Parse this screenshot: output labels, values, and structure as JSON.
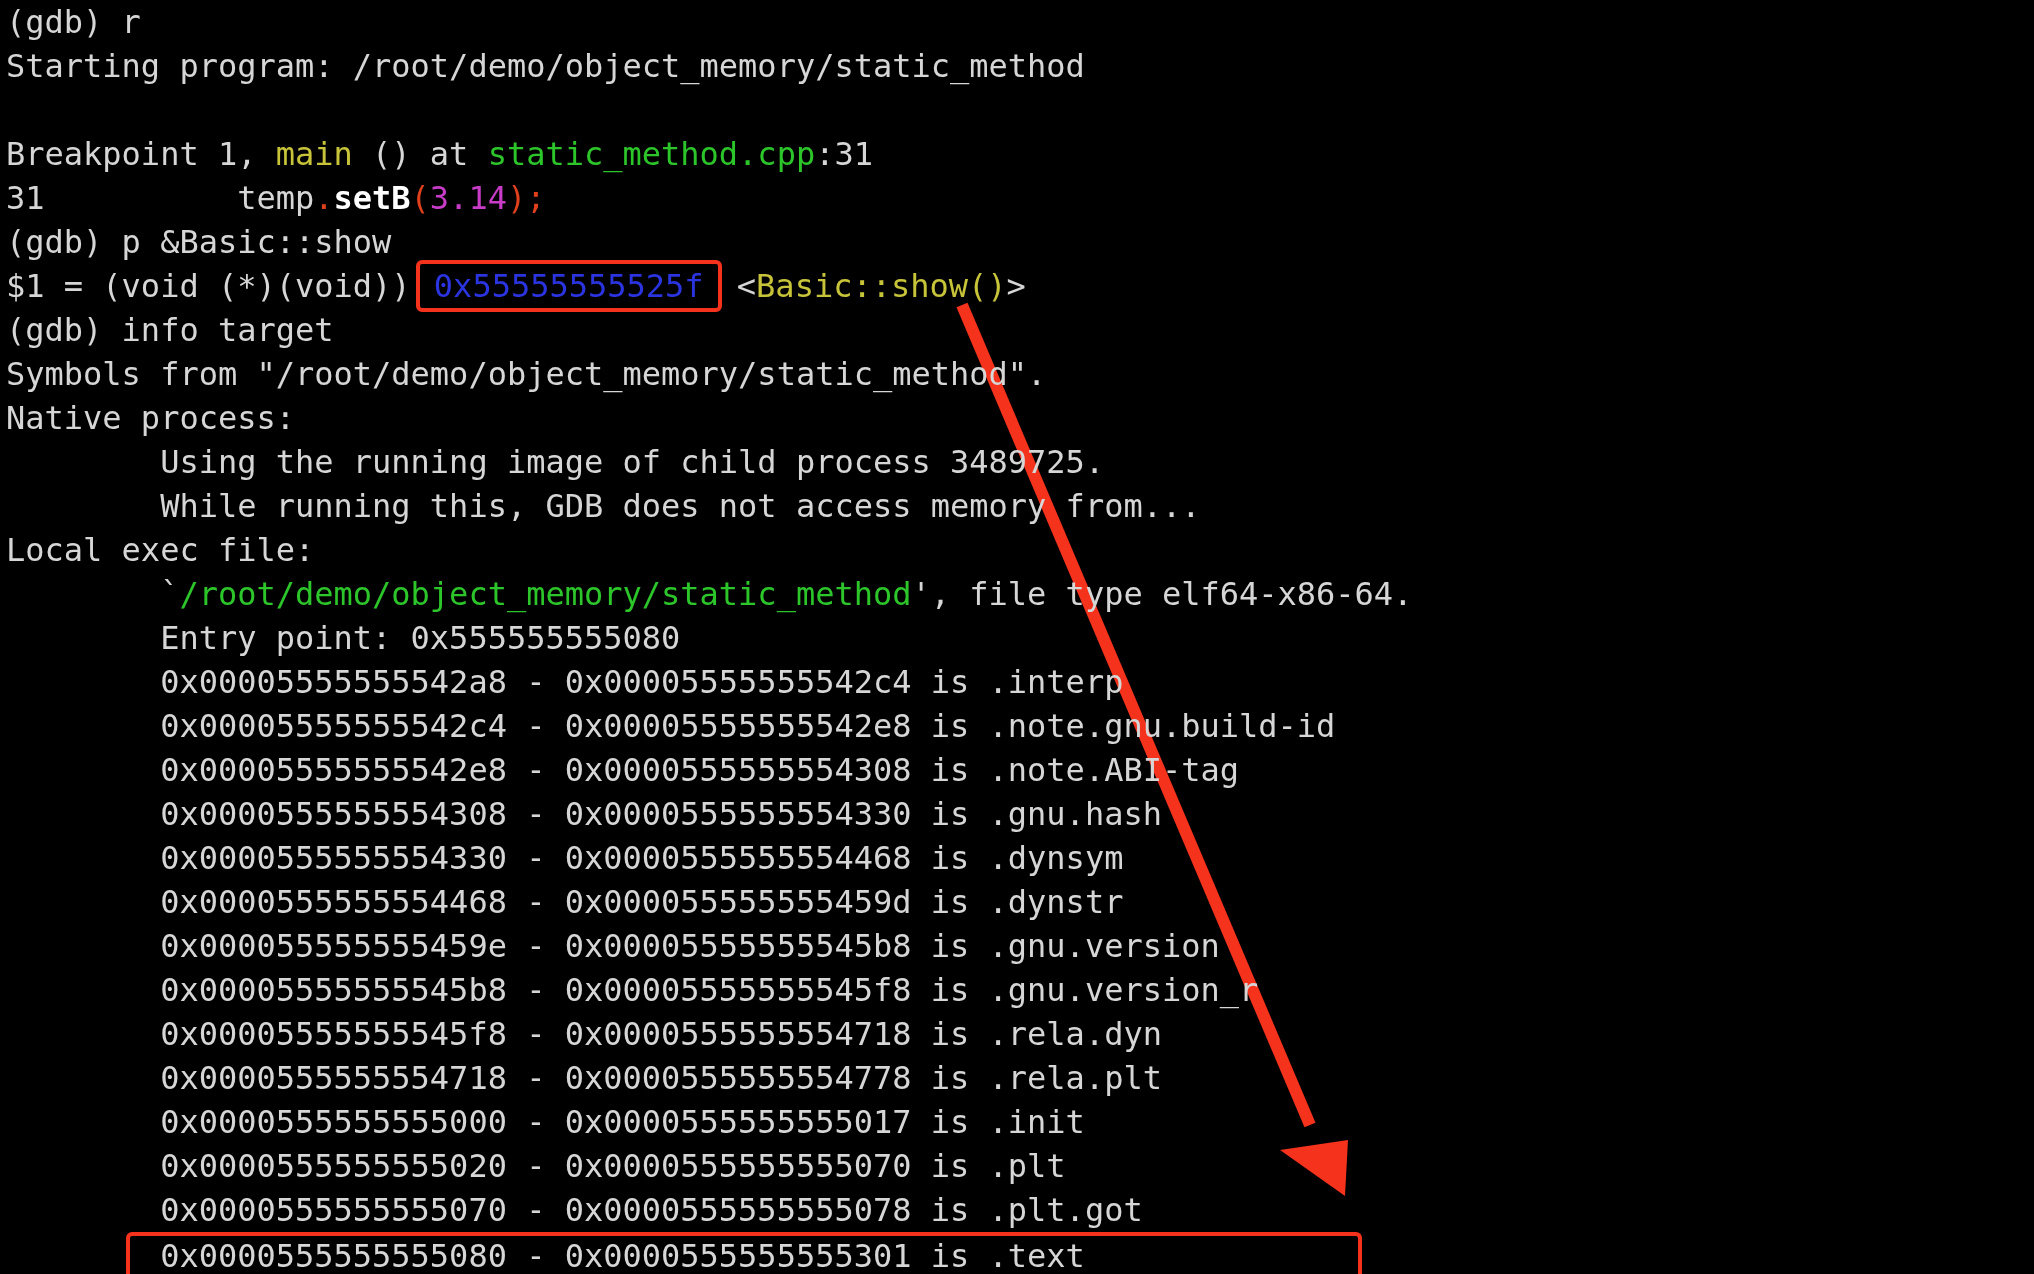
{
  "terminal": {
    "lines": [
      {
        "kind": "text",
        "indent": false,
        "segments": [
          {
            "text": "(gdb) r",
            "kind": "plain"
          }
        ]
      },
      {
        "kind": "text",
        "indent": false,
        "segments": [
          {
            "text": "Starting program: /root/demo/object_memory/static_method",
            "kind": "plain"
          }
        ]
      },
      {
        "kind": "blank"
      },
      {
        "kind": "text",
        "indent": false,
        "segments": [
          {
            "text": "Breakpoint 1, ",
            "kind": "plain"
          },
          {
            "text": "main",
            "kind": "yellow"
          },
          {
            "text": " () at ",
            "kind": "plain"
          },
          {
            "text": "static_method.cpp",
            "kind": "green"
          },
          {
            "text": ":31",
            "kind": "plain"
          }
        ]
      },
      {
        "kind": "text",
        "indent": false,
        "segments": [
          {
            "text": "31",
            "kind": "lineno"
          },
          {
            "text": "temp",
            "kind": "plain"
          },
          {
            "text": ".",
            "kind": "red"
          },
          {
            "text": "setB",
            "kind": "bold"
          },
          {
            "text": "(",
            "kind": "red"
          },
          {
            "text": "3.14",
            "kind": "magenta"
          },
          {
            "text": ");",
            "kind": "red"
          }
        ]
      },
      {
        "kind": "text",
        "indent": false,
        "segments": [
          {
            "text": "(gdb) p &Basic::show",
            "kind": "plain"
          }
        ]
      },
      {
        "kind": "text",
        "indent": false,
        "segments": [
          {
            "text": "$1 = (void (*)(void)) ",
            "kind": "plain"
          },
          {
            "text": "0x55555555525f",
            "kind": "address"
          },
          {
            "text": " <",
            "kind": "plain"
          },
          {
            "text": "Basic::show()",
            "kind": "yellow"
          },
          {
            "text": ">",
            "kind": "plain"
          }
        ]
      },
      {
        "kind": "text",
        "indent": false,
        "segments": [
          {
            "text": "(gdb) info target",
            "kind": "plain"
          }
        ]
      },
      {
        "kind": "text",
        "indent": false,
        "segments": [
          {
            "text": "Symbols from \"/root/demo/object_memory/static_method\".",
            "kind": "plain"
          }
        ]
      },
      {
        "kind": "text",
        "indent": false,
        "segments": [
          {
            "text": "Native process:",
            "kind": "plain"
          }
        ]
      },
      {
        "kind": "text",
        "indent": true,
        "segments": [
          {
            "text": "Using the running image of child process 3489725.",
            "kind": "plain"
          }
        ]
      },
      {
        "kind": "text",
        "indent": true,
        "segments": [
          {
            "text": "While running this, GDB does not access memory from...",
            "kind": "plain"
          }
        ]
      },
      {
        "kind": "text",
        "indent": false,
        "segments": [
          {
            "text": "Local exec file:",
            "kind": "plain"
          }
        ]
      },
      {
        "kind": "text",
        "indent": true,
        "segments": [
          {
            "text": "`",
            "kind": "plain"
          },
          {
            "text": "/root/demo/object_memory/static_method",
            "kind": "green"
          },
          {
            "text": "', file type elf64-x86-64.",
            "kind": "plain"
          }
        ]
      },
      {
        "kind": "text",
        "indent": true,
        "segments": [
          {
            "text": "Entry point: 0x555555555080",
            "kind": "plain"
          }
        ]
      },
      {
        "kind": "text",
        "indent": true,
        "segments": [
          {
            "text": "0x00005555555542a8 - 0x00005555555542c4 is .interp",
            "kind": "plain"
          }
        ]
      },
      {
        "kind": "text",
        "indent": true,
        "segments": [
          {
            "text": "0x00005555555542c4 - 0x00005555555542e8 is .note.gnu.build-id",
            "kind": "plain"
          }
        ]
      },
      {
        "kind": "text",
        "indent": true,
        "segments": [
          {
            "text": "0x00005555555542e8 - 0x0000555555554308 is .note.ABI-tag",
            "kind": "plain"
          }
        ]
      },
      {
        "kind": "text",
        "indent": true,
        "segments": [
          {
            "text": "0x0000555555554308 - 0x0000555555554330 is .gnu.hash",
            "kind": "plain"
          }
        ]
      },
      {
        "kind": "text",
        "indent": true,
        "segments": [
          {
            "text": "0x0000555555554330 - 0x0000555555554468 is .dynsym",
            "kind": "plain"
          }
        ]
      },
      {
        "kind": "text",
        "indent": true,
        "segments": [
          {
            "text": "0x0000555555554468 - 0x000055555555459d is .dynstr",
            "kind": "plain"
          }
        ]
      },
      {
        "kind": "text",
        "indent": true,
        "segments": [
          {
            "text": "0x000055555555459e - 0x00005555555545b8 is .gnu.version",
            "kind": "plain"
          }
        ]
      },
      {
        "kind": "text",
        "indent": true,
        "segments": [
          {
            "text": "0x00005555555545b8 - 0x00005555555545f8 is .gnu.version_r",
            "kind": "plain"
          }
        ]
      },
      {
        "kind": "text",
        "indent": true,
        "segments": [
          {
            "text": "0x00005555555545f8 - 0x0000555555554718 is .rela.dyn",
            "kind": "plain"
          }
        ]
      },
      {
        "kind": "text",
        "indent": true,
        "segments": [
          {
            "text": "0x0000555555554718 - 0x0000555555554778 is .rela.plt",
            "kind": "plain"
          }
        ]
      },
      {
        "kind": "text",
        "indent": true,
        "segments": [
          {
            "text": "0x0000555555555000 - 0x0000555555555017 is .init",
            "kind": "plain"
          }
        ]
      },
      {
        "kind": "text",
        "indent": true,
        "segments": [
          {
            "text": "0x0000555555555020 - 0x0000555555555070 is .plt",
            "kind": "plain"
          }
        ]
      },
      {
        "kind": "text",
        "indent": true,
        "segments": [
          {
            "text": "0x0000555555555070 - 0x0000555555555078 is .plt.got",
            "kind": "plain"
          }
        ]
      },
      {
        "kind": "highlighted",
        "indent": true,
        "segments": [
          {
            "text": "0x0000555555555080 - 0x0000555555555301 is .text",
            "kind": "plain"
          }
        ]
      }
    ]
  }
}
